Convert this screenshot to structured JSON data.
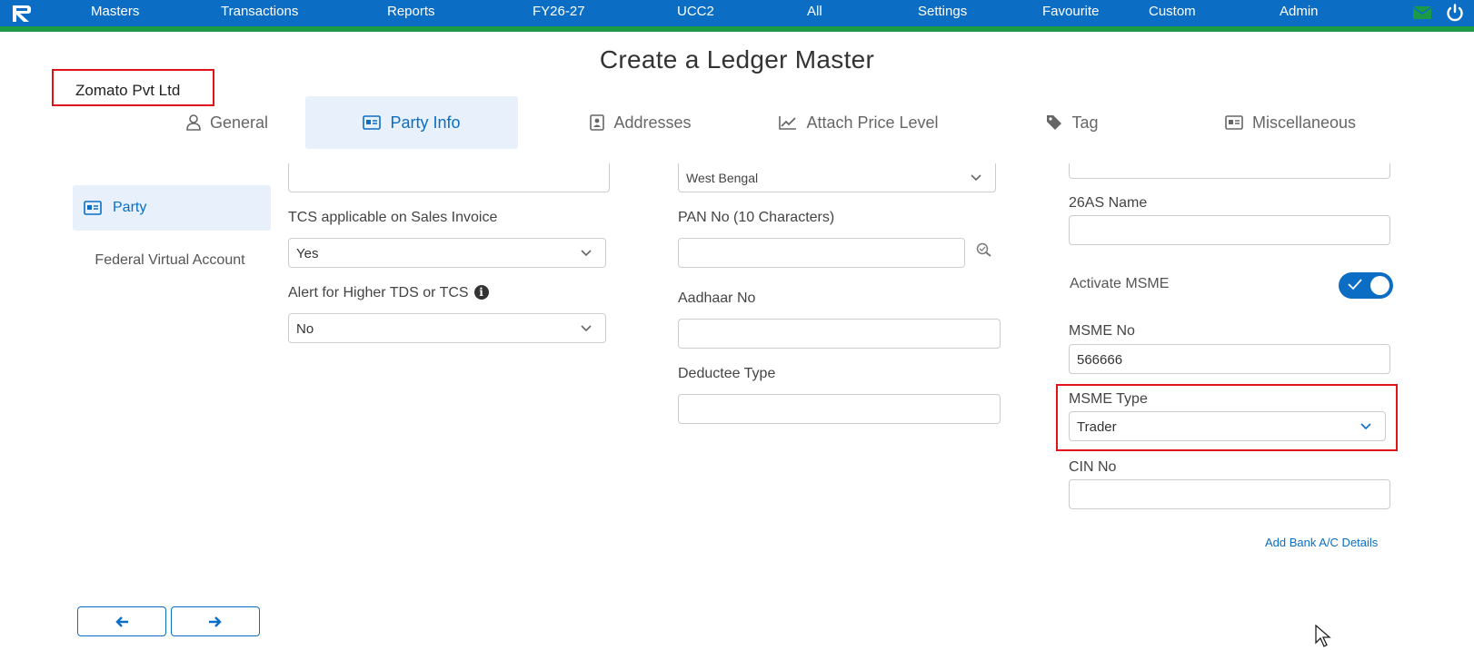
{
  "nav": {
    "items": [
      "Masters",
      "Transactions",
      "Reports",
      "FY26-27",
      "UCC2",
      "All",
      "Settings",
      "Favourite",
      "Custom",
      "Admin"
    ],
    "right_icons": [
      "mail-icon",
      "power-icon"
    ]
  },
  "page": {
    "title": "Create a Ledger Master"
  },
  "company": {
    "name": "Zomato Pvt Ltd"
  },
  "tabs": [
    {
      "label": "General",
      "icon": "user-icon",
      "active": false
    },
    {
      "label": "Party Info",
      "icon": "id-card-icon",
      "active": true
    },
    {
      "label": "Addresses",
      "icon": "address-book-icon",
      "active": false
    },
    {
      "label": "Attach Price Level",
      "icon": "line-chart-icon",
      "active": false
    },
    {
      "label": "Tag",
      "icon": "tag-icon",
      "active": false
    },
    {
      "label": "Miscellaneous",
      "icon": "id-card-icon",
      "active": false
    }
  ],
  "sidebar": {
    "items": [
      {
        "label": "Party",
        "active": true
      },
      {
        "label": "Federal Virtual Account",
        "active": false
      }
    ]
  },
  "form": {
    "col1": {
      "top_field_value": "",
      "tcs_label": "TCS applicable on Sales Invoice",
      "tcs_value": "Yes",
      "alert_label": "Alert for Higher TDS or TCS",
      "alert_value": "No"
    },
    "col2": {
      "state_value": "West Bengal",
      "pan_label": "PAN No (10 Characters)",
      "pan_value": "",
      "aadhaar_label": "Aadhaar No",
      "aadhaar_value": "",
      "deductee_label": "Deductee Type",
      "deductee_value": ""
    },
    "col3": {
      "top_field_value": "",
      "as26_label": "26AS Name",
      "as26_value": "",
      "msme_toggle_label": "Activate MSME",
      "msme_toggle_on": true,
      "msme_no_label": "MSME No",
      "msme_no_value": "566666",
      "msme_type_label": "MSME Type",
      "msme_type_value": "Trader",
      "cin_label": "CIN No",
      "cin_value": "",
      "bank_link": "Add Bank A/C Details"
    }
  },
  "footer": {
    "prev_icon": "arrow-left-icon",
    "next_icon": "arrow-right-icon"
  },
  "colors": {
    "brand_blue": "#0b6ec4",
    "accent_green": "#1c9b47",
    "highlight_red": "#e0121c",
    "active_bg": "#e7f0fb"
  }
}
